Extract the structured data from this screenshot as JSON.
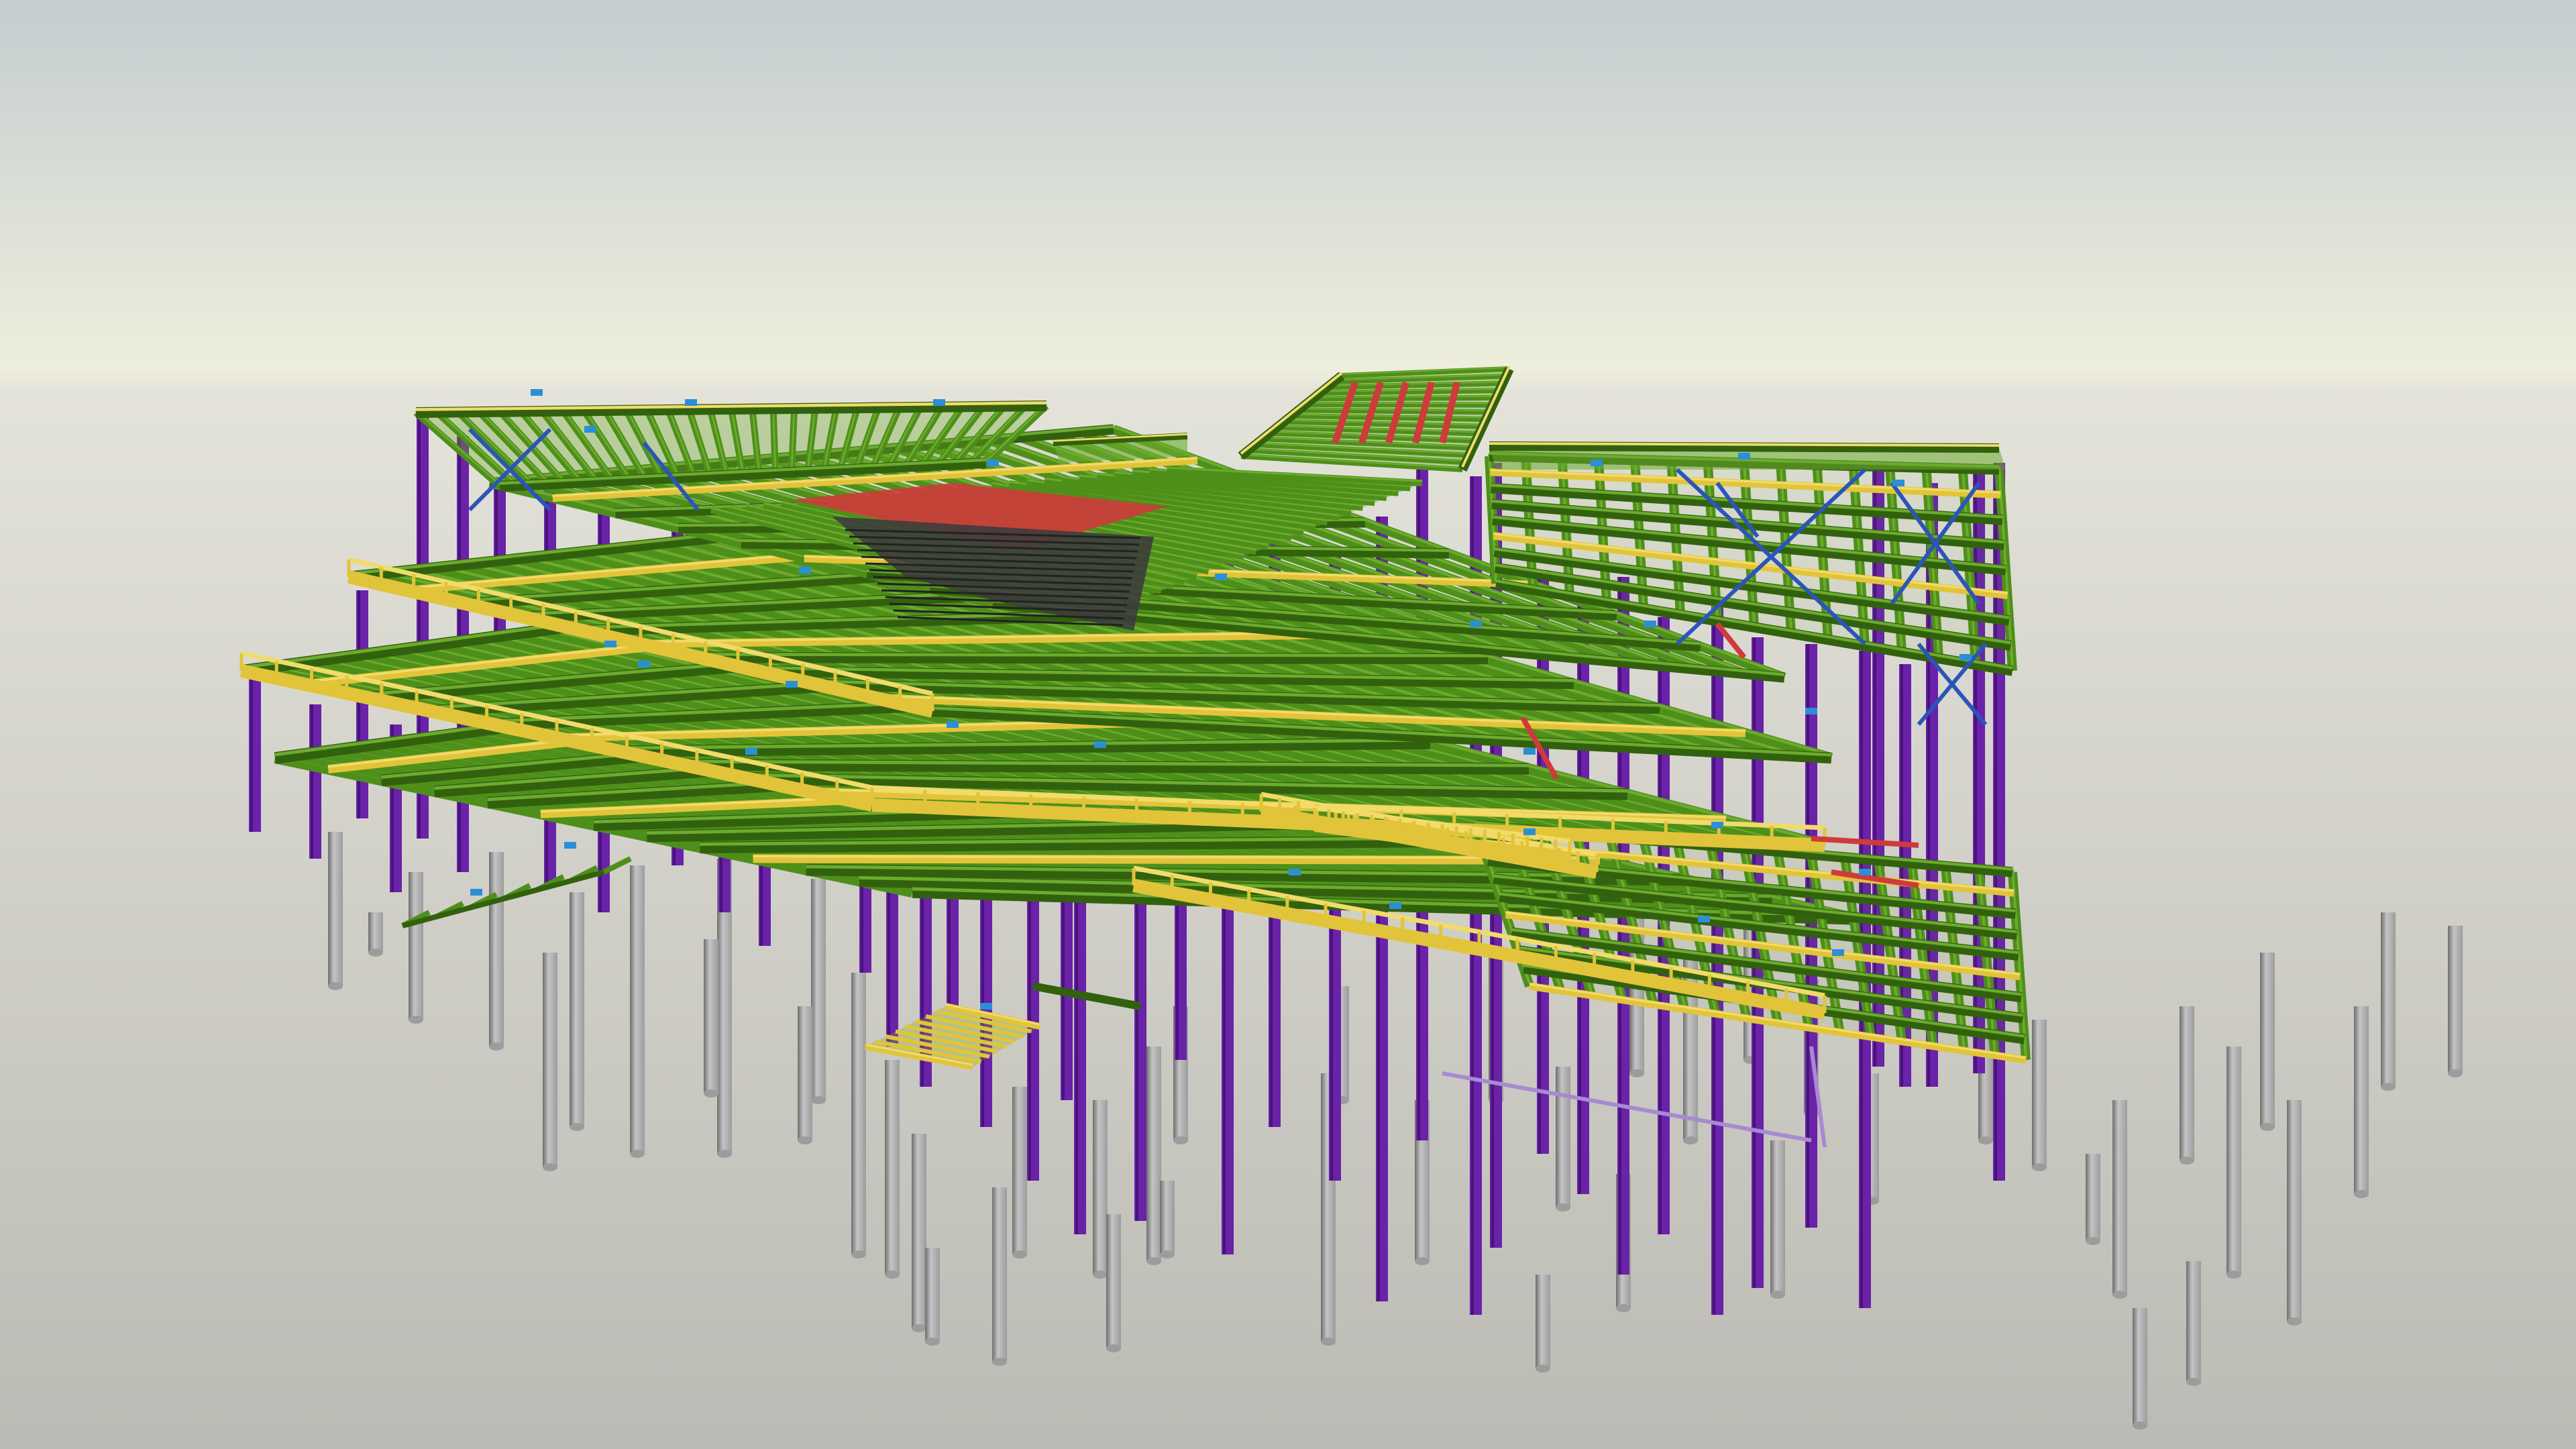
{
  "viewport": {
    "scene": "structural-steel-frame-model",
    "background": {
      "sky_top": "#c4cdd0",
      "sky_horizon": "#eeeedc",
      "ground_horizon": "#e4e3da",
      "ground_bottom": "#bbbab4"
    },
    "member_colors": {
      "column": "#6a22a8",
      "column_edge": "#4a127c",
      "beam": "#4e8f1a",
      "beam_light": "#6cab2e",
      "beam_dark": "#32610e",
      "secondary_beam": "#e2c43a",
      "secondary_light": "#f1db6a",
      "special_beam": "#cf3a3c",
      "bracing": "#2c55b8",
      "connection": "#2b8fd6",
      "pile": "#9c9c9c",
      "pile_light": "#c4c4c4",
      "pile_dark": "#6e6e6e",
      "roof_deck": "#3b3b3b",
      "slab_edge": "#a78ad0"
    }
  }
}
